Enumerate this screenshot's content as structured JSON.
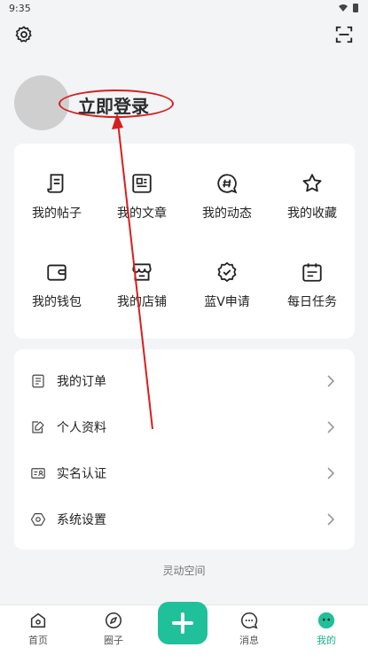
{
  "status": {
    "time": "9:35"
  },
  "profile": {
    "login_label": "立即登录"
  },
  "grid": [
    {
      "label": "我的帖子",
      "icon": "note-icon"
    },
    {
      "label": "我的文章",
      "icon": "article-icon"
    },
    {
      "label": "我的动态",
      "icon": "hashtag-chat-icon"
    },
    {
      "label": "我的收藏",
      "icon": "star-icon"
    },
    {
      "label": "我的钱包",
      "icon": "wallet-icon"
    },
    {
      "label": "我的店铺",
      "icon": "store-icon"
    },
    {
      "label": "蓝V申请",
      "icon": "verified-badge-icon"
    },
    {
      "label": "每日任务",
      "icon": "calendar-icon"
    }
  ],
  "list": [
    {
      "label": "我的订单",
      "icon": "order-icon"
    },
    {
      "label": "个人资料",
      "icon": "edit-profile-icon"
    },
    {
      "label": "实名认证",
      "icon": "id-card-icon"
    },
    {
      "label": "系统设置",
      "icon": "settings-hex-icon"
    }
  ],
  "footer": {
    "text": "灵动空间"
  },
  "nav": {
    "home": "首页",
    "circle": "圈子",
    "messages": "消息",
    "me": "我的"
  },
  "colors": {
    "accent": "#20c09a",
    "annotation": "#d61f1f"
  }
}
